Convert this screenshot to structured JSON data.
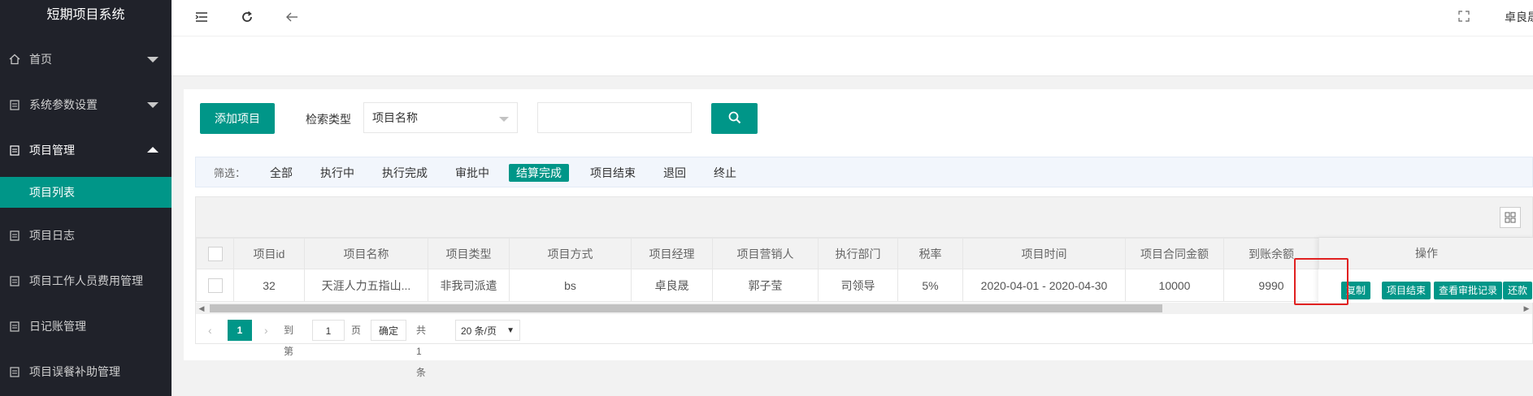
{
  "app": {
    "title": "短期项目系统",
    "accent": "#009688",
    "sidebar_bg": "#20222a"
  },
  "sidebar": {
    "items": [
      {
        "label": "首页",
        "icon": "home-icon"
      },
      {
        "label": "系统参数设置",
        "icon": "document-icon"
      },
      {
        "label": "项目管理",
        "icon": "document-icon"
      },
      {
        "label": "项目日志",
        "icon": "document-icon"
      },
      {
        "label": "项目工作人员费用管理",
        "icon": "document-icon"
      },
      {
        "label": "日记账管理",
        "icon": "document-icon"
      },
      {
        "label": "项目误餐补助管理",
        "icon": "document-icon"
      }
    ],
    "sub_active": "项目列表"
  },
  "header": {
    "user": "卓良晟"
  },
  "toolbar": {
    "add_label": "添加项目",
    "search_type_label": "检索类型",
    "search_type_value": "项目名称",
    "search_placeholder": ""
  },
  "filter": {
    "label": "筛选：",
    "items": [
      "全部",
      "执行中",
      "执行完成",
      "审批中",
      "结算完成",
      "项目结束",
      "退回",
      "终止"
    ],
    "active": "结算完成"
  },
  "table": {
    "columns": [
      "项目id",
      "项目名称",
      "项目类型",
      "项目方式",
      "项目经理",
      "项目营销人",
      "执行部门",
      "税率",
      "项目时间",
      "项目合同金额",
      "到账余额"
    ],
    "ops_header": "操作",
    "rows": [
      {
        "id": "32",
        "name": "天涯人力五指山...",
        "type": "非我司派遣",
        "mode": "bs",
        "manager": "卓良晟",
        "marketer": "郭子莹",
        "dept": "司领导",
        "rate": "5%",
        "time": "2020-04-01 - 2020-04-30",
        "amount": "10000",
        "balance": "9990"
      }
    ],
    "ops": [
      "复制",
      "项目结束",
      "查看审批记录",
      "还款"
    ]
  },
  "pager": {
    "current": "1",
    "goto_label": "到第",
    "goto_value": "1",
    "page_unit": "页",
    "confirm": "确定",
    "total": "共 1 条",
    "size": "20 条/页"
  }
}
